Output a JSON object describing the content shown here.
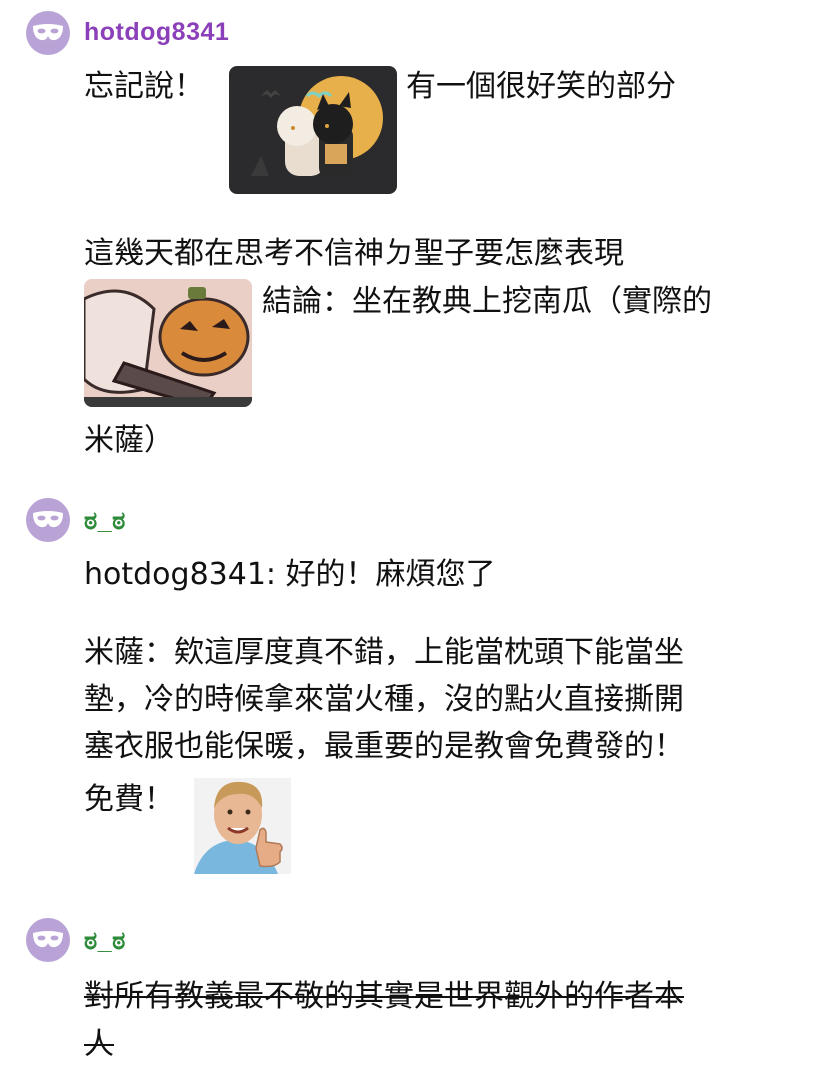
{
  "messages": [
    {
      "username": "hotdog8341",
      "username_color": "#8b3fb8",
      "lines": [
        "忘記說！",
        "有一個很好笑的部分",
        "這幾天都在思考不信神ㄉ聖子要怎麼表現",
        "結論：坐在教典上挖南瓜（實際的",
        "米薩）"
      ]
    },
    {
      "username": "ಠ_ಠ",
      "username_color": "#2e8b3a",
      "lines": [
        "hotdog8341: 好的！麻煩您了",
        "米薩：欸這厚度真不錯，上能當枕頭下能當坐",
        "墊，冷的時候拿來當火種，沒的點火直接撕開",
        "塞衣服也能保暖，最重要的是教會免費發的！",
        "免費！"
      ]
    },
    {
      "username": "ಠ_ಠ",
      "username_color": "#2e8b3a",
      "lines": [
        "對所有教義最不敬的其實是世界觀外的作者本",
        "人"
      ]
    }
  ],
  "icons": {
    "avatar": "mask-icon",
    "sticker1": "anime-duo-halloween-sticker",
    "sticker2": "pumpkin-book-sticker",
    "sticker3": "thumbs-up-guy-sticker"
  }
}
